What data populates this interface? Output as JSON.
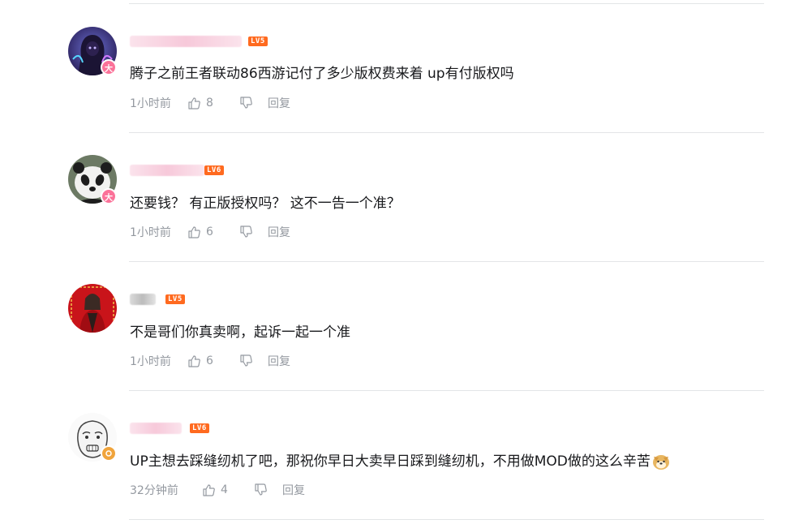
{
  "comments": [
    {
      "level": "LV5",
      "badge": "大",
      "text": "腾子之前王者联动86西游记付了多少版权费来着 up有付版权吗",
      "time": "1小时前",
      "likes": "8",
      "reply": "回复",
      "avatar_icon": "hooded-figure-avatar"
    },
    {
      "level": "LV6",
      "badge": "大",
      "text": "还要钱？ 有正版授权吗？ 这不一告一个准？",
      "time": "1小时前",
      "likes": "6",
      "reply": "回复",
      "avatar_icon": "panda-avatar"
    },
    {
      "level": "LV5",
      "text": "不是哥们你真卖啊，起诉一起一个准",
      "time": "1小时前",
      "likes": "6",
      "reply": "回复",
      "avatar_icon": "red-poster-avatar"
    },
    {
      "level": "LV6",
      "text": "UP主想去踩缝纫机了吧，那祝你早日大卖早日踩到缝纫机，不用做MOD做的这么辛苦",
      "time": "32分钟前",
      "likes": "4",
      "reply": "回复",
      "avatar_icon": "meme-face-avatar",
      "emoji": "doge-emoji"
    }
  ],
  "colors": {
    "level_badge": "#ff6a1f",
    "vip_badge": "#fb7299",
    "meta_text": "#9499a0",
    "divider": "#e3e5e7"
  }
}
